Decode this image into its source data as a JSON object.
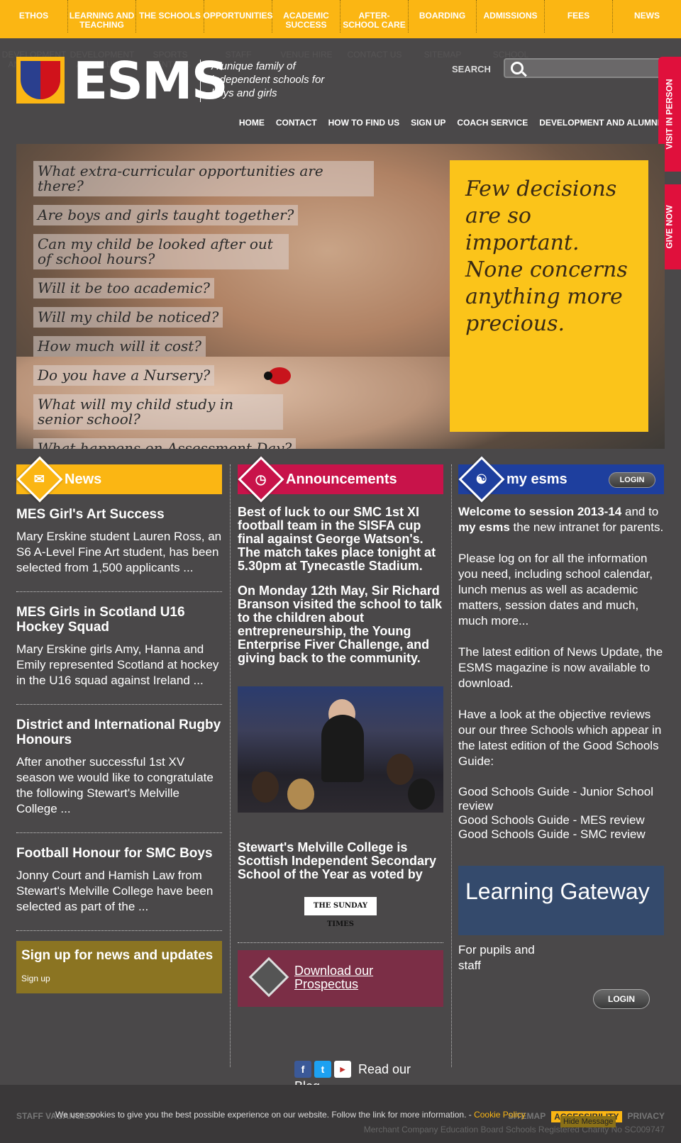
{
  "topnav": [
    "ETHOS",
    "LEARNING AND TEACHING",
    "THE SCHOOLS",
    "OPPORTUNITIES",
    "ACADEMIC SUCCESS",
    "AFTER-SCHOOL CARE",
    "BOARDING",
    "ADMISSIONS",
    "FEES",
    "NEWS"
  ],
  "subnav_ghost": [
    "DEVELOPMENT AND ALUMNI",
    "DEVELOPMENT AND ALUMNI",
    "SPORTS CENTRES",
    "STAFF",
    "VENUE HIRE",
    "CONTACT US",
    "SITEMAP",
    "SCHOOL"
  ],
  "logo": {
    "name": "ESMS",
    "tagline": "A unique family of independent schools for boys and girls"
  },
  "search": {
    "label": "SEARCH",
    "placeholder": ""
  },
  "headnav": [
    "HOME",
    "CONTACT",
    "HOW TO FIND US",
    "SIGN UP",
    "COACH SERVICE",
    "DEVELOPMENT AND ALUMNI"
  ],
  "sidetabs": {
    "visit": "VISIT IN PERSON",
    "give": "GIVE NOW"
  },
  "hero": {
    "questions": [
      "What extra-curricular opportunities are there?",
      "Are boys and girls taught together?",
      "Can my child be looked after out of school hours?",
      "Will it be too academic?",
      "Will my child be noticed?",
      "How much will it cost?",
      "Do you have a Nursery?",
      "What will my child study in senior school?",
      "What happens on Assessment Day?"
    ],
    "quote": "Few decisions are so important. None concerns anything more precious."
  },
  "news": {
    "title": "News",
    "items": [
      {
        "headline": "MES Girl's Art Success",
        "summary": "Mary Erskine student Lauren Ross, an S6 A-Level Fine Art student, has been selected from 1,500 applicants ..."
      },
      {
        "headline": "MES Girls in Scotland U16 Hockey Squad",
        "summary": "Mary Erskine girls Amy, Hanna and Emily represented Scotland at hockey in the U16 squad against Ireland ..."
      },
      {
        "headline": "District and International Rugby Honours",
        "summary": "After another successful 1st XV season we would like to congratulate the following Stewart's Melville College ..."
      },
      {
        "headline": "Football Honour for SMC Boys",
        "summary": "Jonny Court and Hamish Law from Stewart's Melville College have been selected as part of the ..."
      }
    ],
    "signup_title": "Sign up for news and updates",
    "signup_link": "Sign up"
  },
  "announcements": {
    "title": "Announcements",
    "items": [
      "Best of luck to our SMC 1st XI football team in the SISFA cup final against George Watson's. The match takes place tonight at 5.30pm at Tynecastle Stadium.",
      "On Monday 12th May, Sir Richard Branson visited the school to talk to the children about entrepreneurship, the Young Enterprise Fiver Challenge, and giving back to the community."
    ],
    "award": "Stewart's Melville College is Scottish Independent Secondary School of the Year as voted by",
    "award_logo": "THE SUNDAY TIMES",
    "prospectus": "Download our Prospectus",
    "read_our": "Read our",
    "blog": "Blog"
  },
  "myesms": {
    "title": "my esms",
    "login": "LOGIN",
    "welcome_bold": "Welcome to session 2013-14",
    "welcome_rest_1": "and to",
    "welcome_bold_2": "my esms",
    "welcome_rest_2": "the new intranet for parents.",
    "para2": "Please log on for all the information you need, including school calendar, lunch menus as well as academic matters, session dates and much, much more...",
    "para3": "The latest edition of News Update, the ESMS magazine is now available to download.",
    "para4": "Have a look at the objective reviews our our three Schools which appear in the latest edition of the Good Schools Guide:",
    "gsg_links": [
      "Good Schools Guide - Junior School review",
      "Good Schools Guide - MES review",
      "Good Schools Guide - SMC review"
    ],
    "gateway_title": "Learning Gateway",
    "gateway_sub": "For pupils and staff",
    "gateway_login": "LOGIN"
  },
  "footer": {
    "left": "STAFF VACANCIES",
    "right_links": [
      "SITEMAP",
      "ACCESSIBILITY",
      "PRIVACY"
    ],
    "legal": "Merchant Company Education Board Schools Registered Charity No SC009747",
    "cookie_text": "We use cookies to give you the best possible experience on our website. Follow the link for more information. -",
    "cookie_link": "Cookie Policy",
    "hide": "Hide Message"
  },
  "colors": {
    "yellow": "#fbb613",
    "crimson": "#c8134a",
    "blue": "#1e3f9e",
    "background": "#4a4849"
  }
}
